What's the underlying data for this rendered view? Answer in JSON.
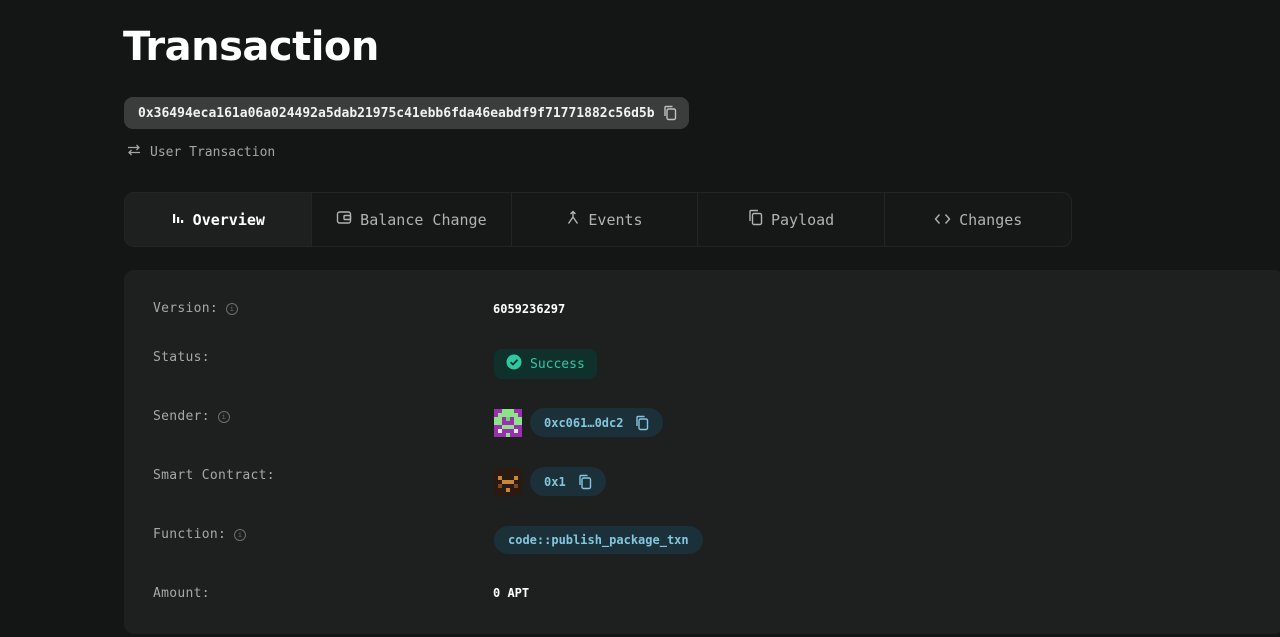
{
  "page": {
    "title": "Transaction"
  },
  "transaction": {
    "hash": "0x36494eca161a06a024492a5dab21975c41ebb6fda46eabdf9f71771882c56d5b",
    "type": "User Transaction"
  },
  "tabs": [
    {
      "label": "Overview",
      "icon": "bar-chart-icon",
      "active": true
    },
    {
      "label": "Balance Change",
      "icon": "wallet-icon",
      "active": false
    },
    {
      "label": "Events",
      "icon": "merge-icon",
      "active": false
    },
    {
      "label": "Payload",
      "icon": "copy-pages-icon",
      "active": false
    },
    {
      "label": "Changes",
      "icon": "code-brackets-icon",
      "active": false
    }
  ],
  "overview": {
    "version": {
      "label": "Version:",
      "value": "6059236297"
    },
    "status": {
      "label": "Status:",
      "value": "Success"
    },
    "sender": {
      "label": "Sender:",
      "value": "0xc061…0dc2"
    },
    "smart_contract": {
      "label": "Smart Contract:",
      "value": "0x1"
    },
    "function": {
      "label": "Function:",
      "value": "code::publish_package_txn"
    },
    "amount": {
      "label": "Amount:",
      "value": "0 APT"
    }
  },
  "colors": {
    "background": "#141515",
    "panel": "#1e2020",
    "success": "#2fc9a0",
    "address": "#83c6dd"
  }
}
